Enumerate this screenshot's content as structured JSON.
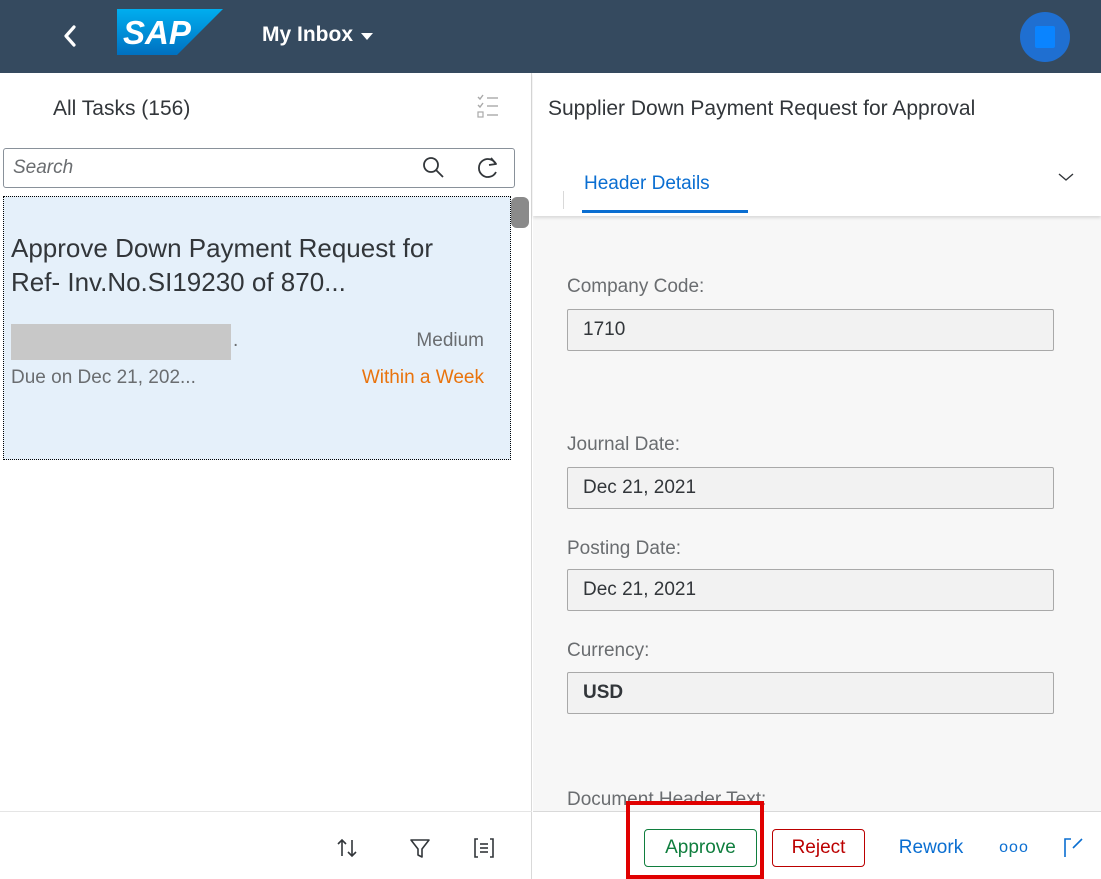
{
  "shell": {
    "app_title": "My Inbox",
    "logo_text": "SAP"
  },
  "master": {
    "title": "All Tasks (156)",
    "search": {
      "placeholder": "Search"
    },
    "task": {
      "title": "Approve Down Payment Request for Ref- Inv.No.SI19230 of 870...",
      "creator_suffix": ".",
      "priority": "Medium",
      "due": "Due on Dec 21, 202...",
      "status": "Within a Week"
    }
  },
  "detail": {
    "title": "Supplier Down Payment Request for Approval",
    "tab_label": "Header Details",
    "fields": {
      "company_code_label": "Company Code:",
      "company_code_value": "1710",
      "journal_date_label": "Journal Date:",
      "journal_date_value": "Dec 21, 2021",
      "posting_date_label": "Posting Date:",
      "posting_date_value": "Dec 21, 2021",
      "currency_label": "Currency:",
      "currency_value": "USD",
      "doc_header_text_label": "Document Header Text:"
    },
    "footer": {
      "approve": "Approve",
      "reject": "Reject",
      "rework": "Rework",
      "more": "ooo"
    }
  },
  "colors": {
    "shell_bg": "#354a5f",
    "accent": "#0a6ed1",
    "positive": "#107e3e",
    "negative": "#bb0000",
    "critical": "#e9730c",
    "selection_bg": "#e5f0fa",
    "highlight": "#e00000"
  },
  "icons": {
    "back": "chevron-left-icon",
    "multi_select": "multi-select-icon",
    "search": "search-icon",
    "refresh": "refresh-icon",
    "sort": "sort-icon",
    "filter": "filter-icon",
    "group": "group-icon",
    "expand": "chevron-down-icon",
    "open": "open-in-new-icon"
  }
}
